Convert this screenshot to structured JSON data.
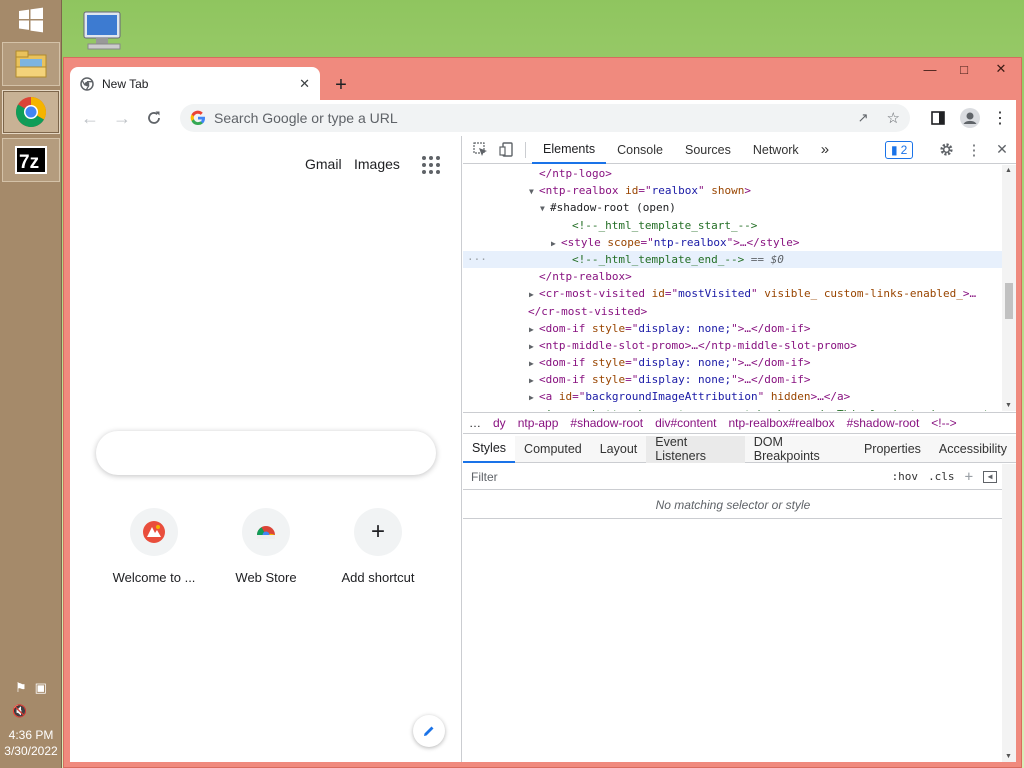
{
  "taskbar": {
    "clock_time": "4:36 PM",
    "clock_date": "3/30/2022",
    "apps": [
      "file-explorer",
      "chrome",
      "7-zip"
    ]
  },
  "browser": {
    "tab_title": "New Tab",
    "omnibox_placeholder": "Search Google or type a URL"
  },
  "ntp": {
    "gmail": "Gmail",
    "images": "Images",
    "shortcuts": [
      {
        "label": "Welcome to ..."
      },
      {
        "label": "Web Store"
      },
      {
        "label": "Add shortcut"
      }
    ]
  },
  "devtools": {
    "tabs": [
      "Elements",
      "Console",
      "Sources",
      "Network"
    ],
    "more": "»",
    "issues_count": "2",
    "elements": [
      {
        "indent": 6,
        "html": "</ntp-logo>",
        "kind": "close"
      },
      {
        "indent": 6,
        "tri": "▼",
        "open": "ntp-realbox",
        "attrs": [
          [
            "id",
            "realbox"
          ],
          [
            "shown",
            null
          ]
        ]
      },
      {
        "indent": 7,
        "tri": "▼",
        "text": "#shadow-root (open)"
      },
      {
        "indent": 9,
        "comment": "<!--_html_template_start_-->"
      },
      {
        "indent": 8,
        "tri": "▶",
        "open": "style",
        "attrs": [
          [
            "scope",
            "ntp-realbox"
          ]
        ],
        "tail": "…</style>"
      },
      {
        "indent": 9,
        "comment": "<!--_html_template_end_-->",
        "sel": true,
        "dollar": " == $0"
      },
      {
        "indent": 6,
        "html": "</ntp-realbox>",
        "kind": "close"
      },
      {
        "indent": 6,
        "tri": "▶",
        "open": "cr-most-visited",
        "attrs": [
          [
            "id",
            "mostVisited"
          ],
          [
            "visible_",
            null
          ],
          [
            "custom-links-enabled_",
            null
          ]
        ],
        "tail": "…"
      },
      {
        "indent": 5,
        "html": "</cr-most-visited>",
        "kind": "close"
      },
      {
        "indent": 6,
        "tri": "▶",
        "open": "dom-if",
        "attrs": [
          [
            "style",
            "display: none;"
          ]
        ],
        "tail": "…</dom-if>"
      },
      {
        "indent": 6,
        "tri": "▶",
        "open": "ntp-middle-slot-promo",
        "attrs": [],
        "tail": "…</ntp-middle-slot-promo>"
      },
      {
        "indent": 6,
        "tri": "▶",
        "open": "dom-if",
        "attrs": [
          [
            "style",
            "display: none;"
          ]
        ],
        "tail": "…</dom-if>"
      },
      {
        "indent": 6,
        "tri": "▶",
        "open": "dom-if",
        "attrs": [
          [
            "style",
            "display: none;"
          ]
        ],
        "tail": "…</dom-if>"
      },
      {
        "indent": 6,
        "tri": "▶",
        "open": "a",
        "attrs": [
          [
            "id",
            "backgroundImageAttribution"
          ],
          [
            "hidden",
            null
          ]
        ],
        "tail": "…</a>"
      },
      {
        "indent": 6,
        "comment": "<!-- cr-button has a transparent background. This leads to incorrect"
      }
    ],
    "breadcrumbs": [
      "…",
      "dy",
      "ntp-app",
      "#shadow-root",
      "div#content",
      "ntp-realbox#realbox",
      "#shadow-root",
      "<!-->"
    ],
    "style_tabs": [
      "Styles",
      "Computed",
      "Layout",
      "Event Listeners",
      "DOM Breakpoints",
      "Properties",
      "Accessibility"
    ],
    "filter_placeholder": "Filter",
    "hov": ":hov",
    "cls": ".cls",
    "no_match": "No matching selector or style"
  }
}
